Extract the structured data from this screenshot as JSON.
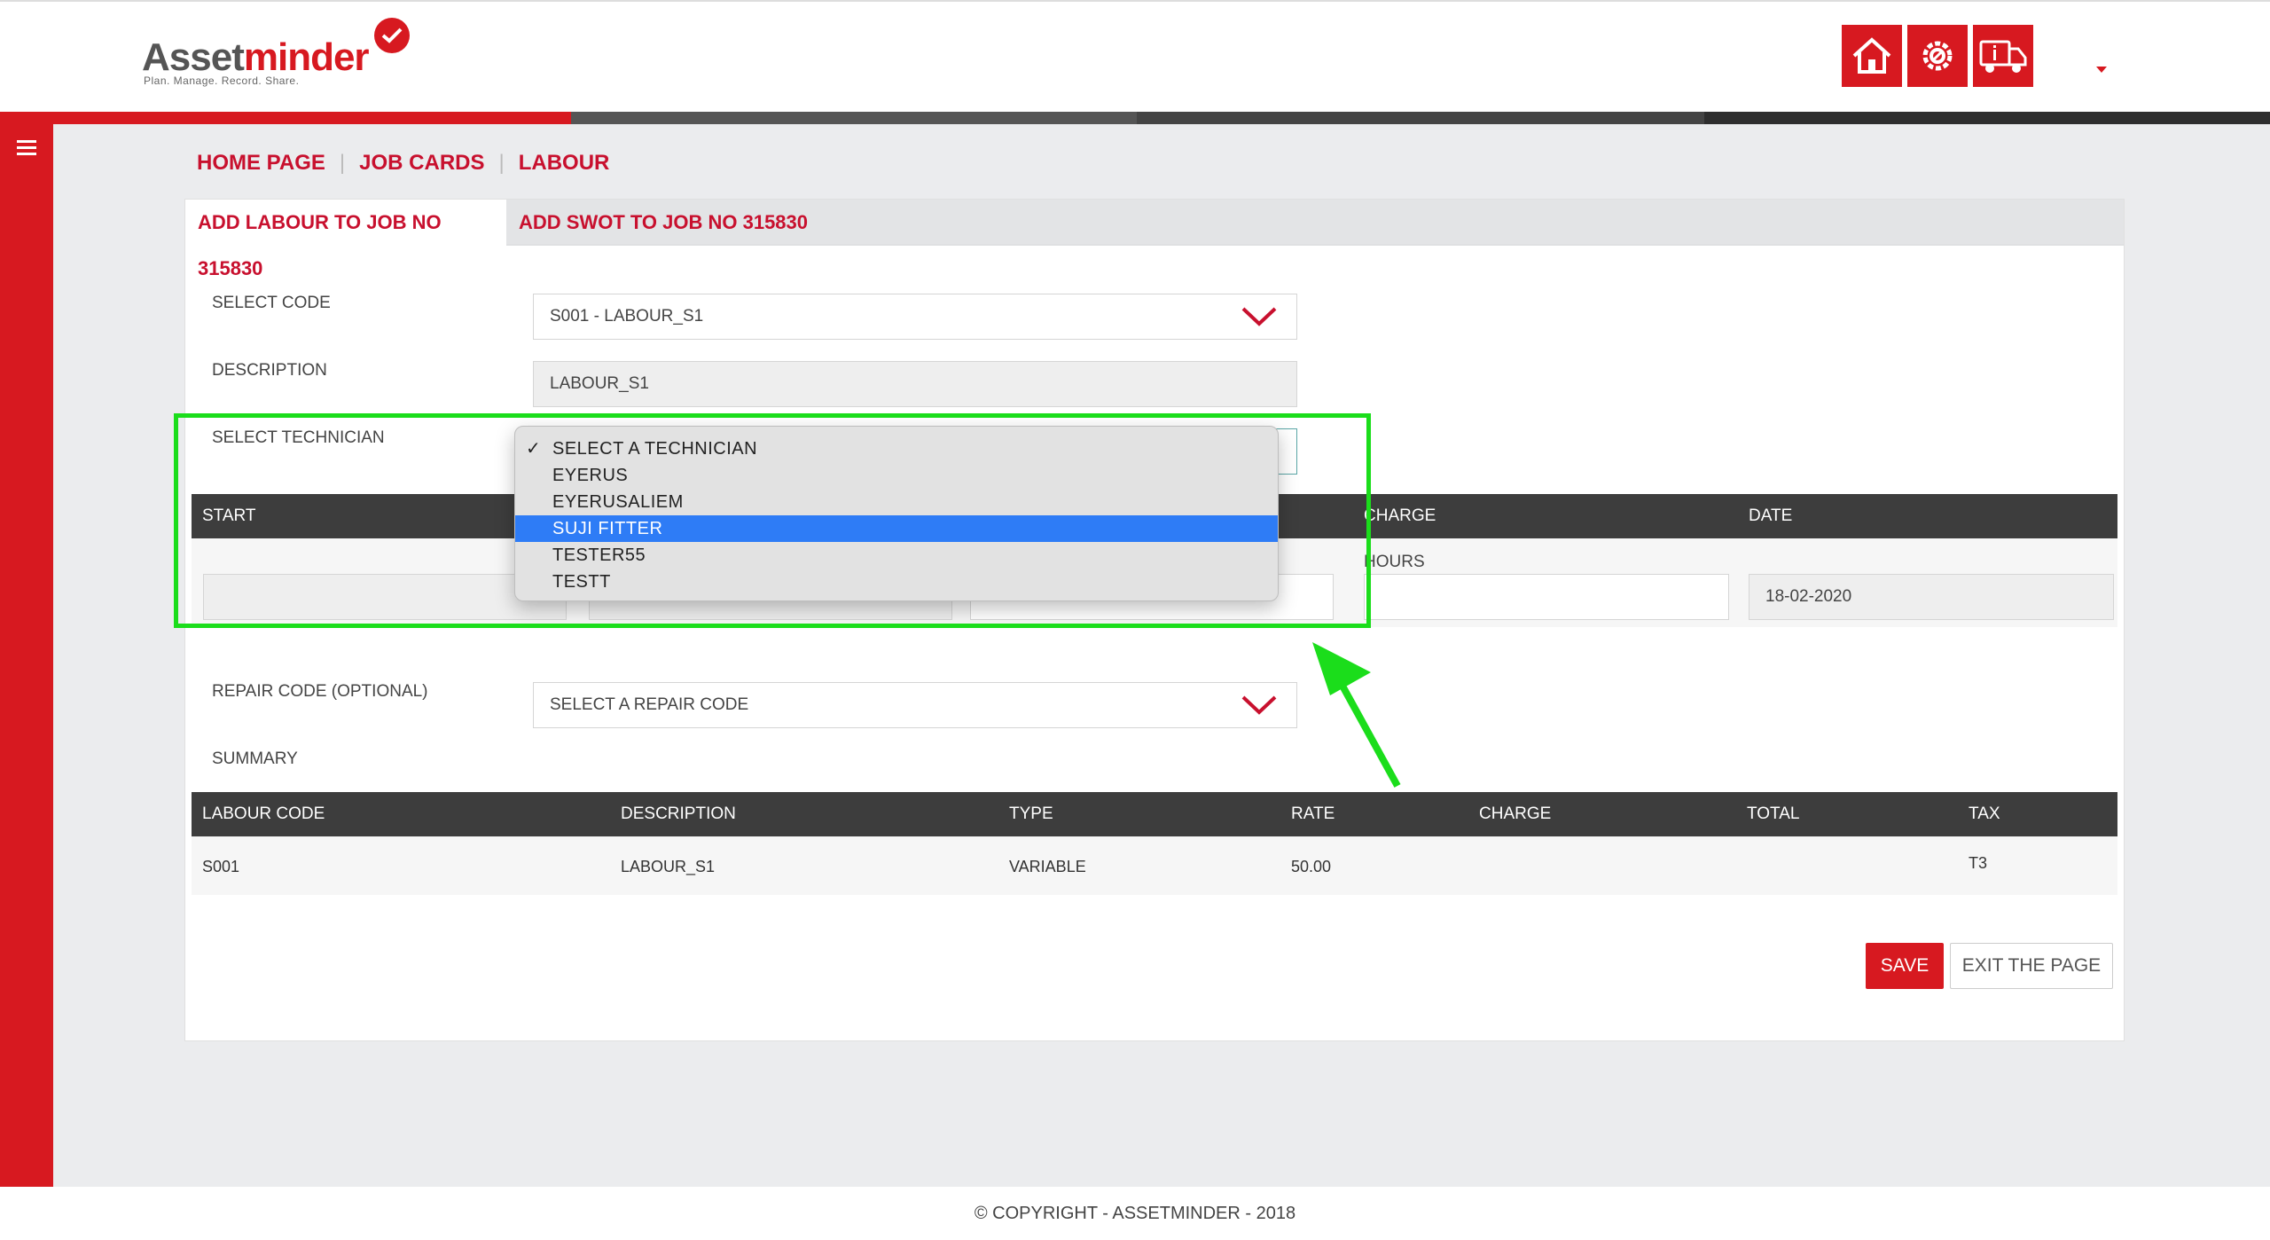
{
  "app": {
    "logo_asset": "Asset",
    "logo_minder": "minder",
    "tagline": "Plan. Manage. Record. Share."
  },
  "header_icons": [
    {
      "name": "home-icon"
    },
    {
      "name": "settings-gear-icon"
    },
    {
      "name": "truck-info-icon"
    }
  ],
  "breadcrumb": {
    "home": "HOME PAGE",
    "job_cards": "JOB CARDS",
    "labour": "LABOUR"
  },
  "tabs": {
    "add_labour": "ADD LABOUR TO JOB NO 315830",
    "add_swot": "ADD SWOT TO JOB NO 315830"
  },
  "form": {
    "select_code_label": "SELECT CODE",
    "select_code_value": "S001 - LABOUR_S1",
    "description_label": "DESCRIPTION",
    "description_value": "LABOUR_S1",
    "select_technician_label": "SELECT TECHNICIAN",
    "repair_code_label": "REPAIR CODE (OPTIONAL)",
    "repair_code_value": "SELECT A REPAIR CODE",
    "summary_label": "SUMMARY"
  },
  "time_grid": {
    "headers": {
      "start": "START",
      "charge": "CHARGE",
      "date": "DATE"
    },
    "charge_sublabel": "HOURS",
    "date_value": "18-02-2020"
  },
  "technician_dropdown": {
    "options": [
      "SELECT A TECHNICIAN",
      "EYERUS",
      "EYERUSALIEM",
      "SUJI FITTER",
      "TESTER55",
      "TESTT"
    ],
    "checked": "SELECT A TECHNICIAN",
    "highlighted": "SUJI FITTER"
  },
  "summary_table": {
    "headers": [
      "LABOUR CODE",
      "DESCRIPTION",
      "TYPE",
      "RATE",
      "CHARGE",
      "TOTAL",
      "TAX"
    ],
    "rows": [
      [
        "S001",
        "LABOUR_S1",
        "VARIABLE",
        "50.00",
        "",
        "",
        "T3"
      ]
    ]
  },
  "buttons": {
    "save": "SAVE",
    "exit": "EXIT THE PAGE"
  },
  "footer": {
    "text": "© COPYRIGHT - ASSETMINDER - 2018"
  },
  "colors": {
    "brand_red": "#d71920",
    "link_red": "#c8102e",
    "highlight_blue": "#2e7cf6",
    "annotation_green": "#1bdd1b",
    "table_header": "#3d3d3d"
  }
}
